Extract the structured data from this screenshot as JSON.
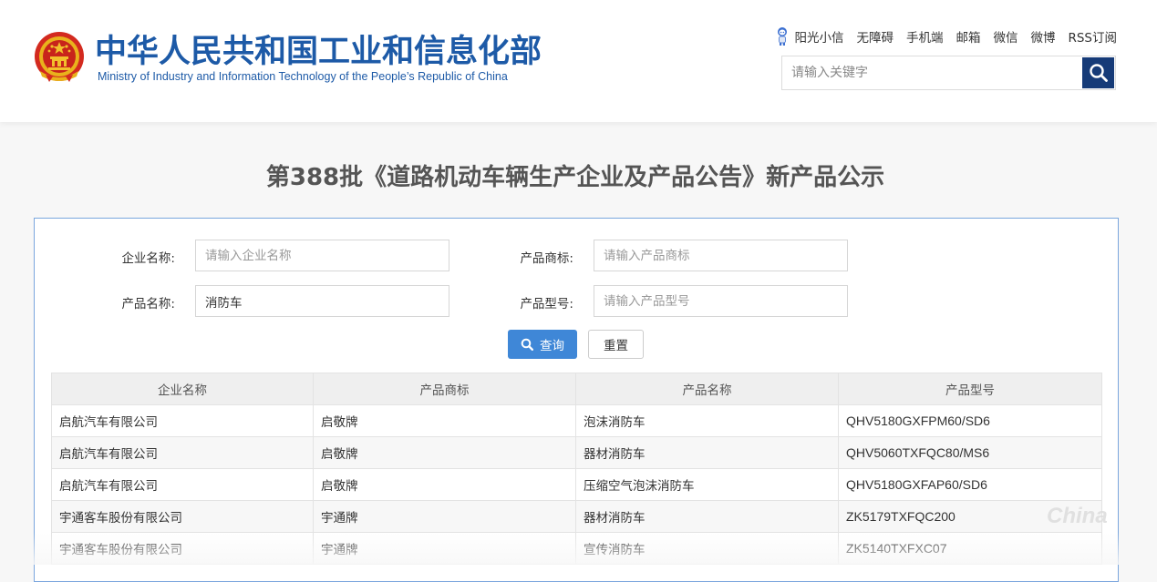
{
  "header": {
    "title_cn": "中华人民共和国工业和信息化部",
    "title_en": "Ministry of Industry and Information Technology of the People’s Republic of China",
    "links": [
      "阳光小信",
      "无障碍",
      "手机端",
      "邮箱",
      "微信",
      "微博",
      "RSS订阅"
    ],
    "search_placeholder": "请输入关键字"
  },
  "page_title": "第388批《道路机动车辆生产企业及产品公告》新产品公示",
  "form": {
    "company_label": "企业名称:",
    "company_placeholder": "请输入企业名称",
    "company_value": "",
    "brand_label": "产品商标:",
    "brand_placeholder": "请输入产品商标",
    "brand_value": "",
    "product_label": "产品名称:",
    "product_placeholder": "",
    "product_value": "消防车",
    "model_label": "产品型号:",
    "model_placeholder": "请输入产品型号",
    "model_value": "",
    "query_label": "查询",
    "reset_label": "重置"
  },
  "table": {
    "headers": [
      "企业名称",
      "产品商标",
      "产品名称",
      "产品型号"
    ],
    "rows": [
      [
        "启航汽车有限公司",
        "启敬牌",
        "泡沫消防车",
        "QHV5180GXFPM60/SD6"
      ],
      [
        "启航汽车有限公司",
        "启敬牌",
        "器材消防车",
        "QHV5060TXFQC80/MS6"
      ],
      [
        "启航汽车有限公司",
        "启敬牌",
        "压缩空气泡沫消防车",
        "QHV5180GXFAP60/SD6"
      ],
      [
        "宇通客车股份有限公司",
        "宇通牌",
        "器材消防车",
        "ZK5179TXFQC200"
      ],
      [
        "宇通客车股份有限公司",
        "宇通牌",
        "宣传消防车",
        "ZK5140TXFXC07"
      ]
    ]
  },
  "watermark": "China",
  "colors": {
    "brand_blue": "#1d5aa7",
    "search_button": "#163b78",
    "query_button": "#3f87d7",
    "panel_border": "#7aa6dd"
  }
}
